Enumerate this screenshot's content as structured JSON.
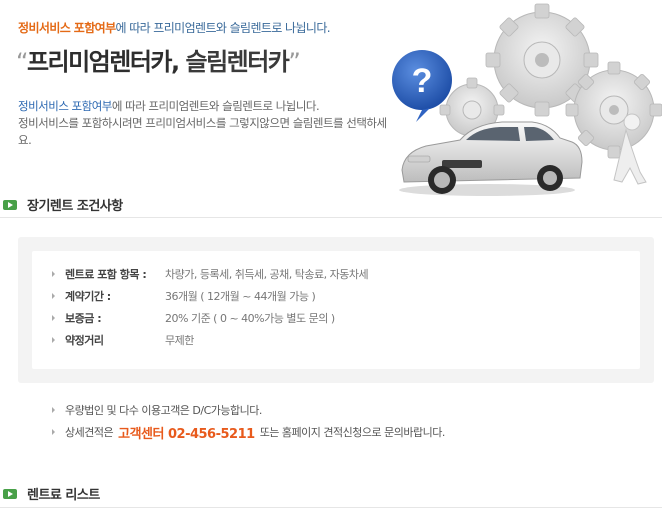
{
  "hero": {
    "subtitle_highlight": "정비서비스 포함여부",
    "subtitle_rest": "에 따라 프리미엄렌트와 슬림렌트로 나뉩니다.",
    "title_open_quote": "“",
    "title_part1": "프리미엄렌터카",
    "title_sep": ", ",
    "title_part2": "슬림렌터카",
    "title_close_quote": "”",
    "desc_line1_blue": "정비서비스 포함여부",
    "desc_line1_rest": "에 따라 프리미엄렌트와 슬림렌트로 나뉩니다.",
    "desc_line2": "정비서비스를 포함하시려면 프리미엄서비스를 그렇지않으면 슬림렌트를 선택하세요."
  },
  "section1": {
    "title": "장기렌트 조건사항"
  },
  "conditions": [
    {
      "label": "렌트료 포함 항목 :",
      "value": "차량가, 등록세, 취득세, 공채, 탁송료, 자동차세"
    },
    {
      "label": "계약기간 :",
      "value": "36개월 ( 12개월 ~ 44개월 가능 )"
    },
    {
      "label": "보증금 :",
      "value": "20% 기준 ( 0 ~ 40%가능 별도 문의 )"
    },
    {
      "label": "약정거리",
      "value": "무제한"
    }
  ],
  "notes": {
    "line1": "우량법인 및 다수 이용고객은 D/C가능합니다.",
    "line2_prefix": "상세견적은",
    "line2_phone": "고객센터 02-456-5211",
    "line2_suffix": "또는 홈페이지 견적신청으로 문의바랍니다."
  },
  "section2": {
    "title": "렌트료 리스트"
  },
  "colors": {
    "accent_orange": "#e85a1c",
    "section_icon_green": "#48a048",
    "text_blue": "#2d69b2",
    "question_bubble": "#2f63c2"
  },
  "icons": [
    "question-mark-icon",
    "gear-icon",
    "car-image",
    "section-arrow-icon",
    "bullet-arrow-icon"
  ]
}
